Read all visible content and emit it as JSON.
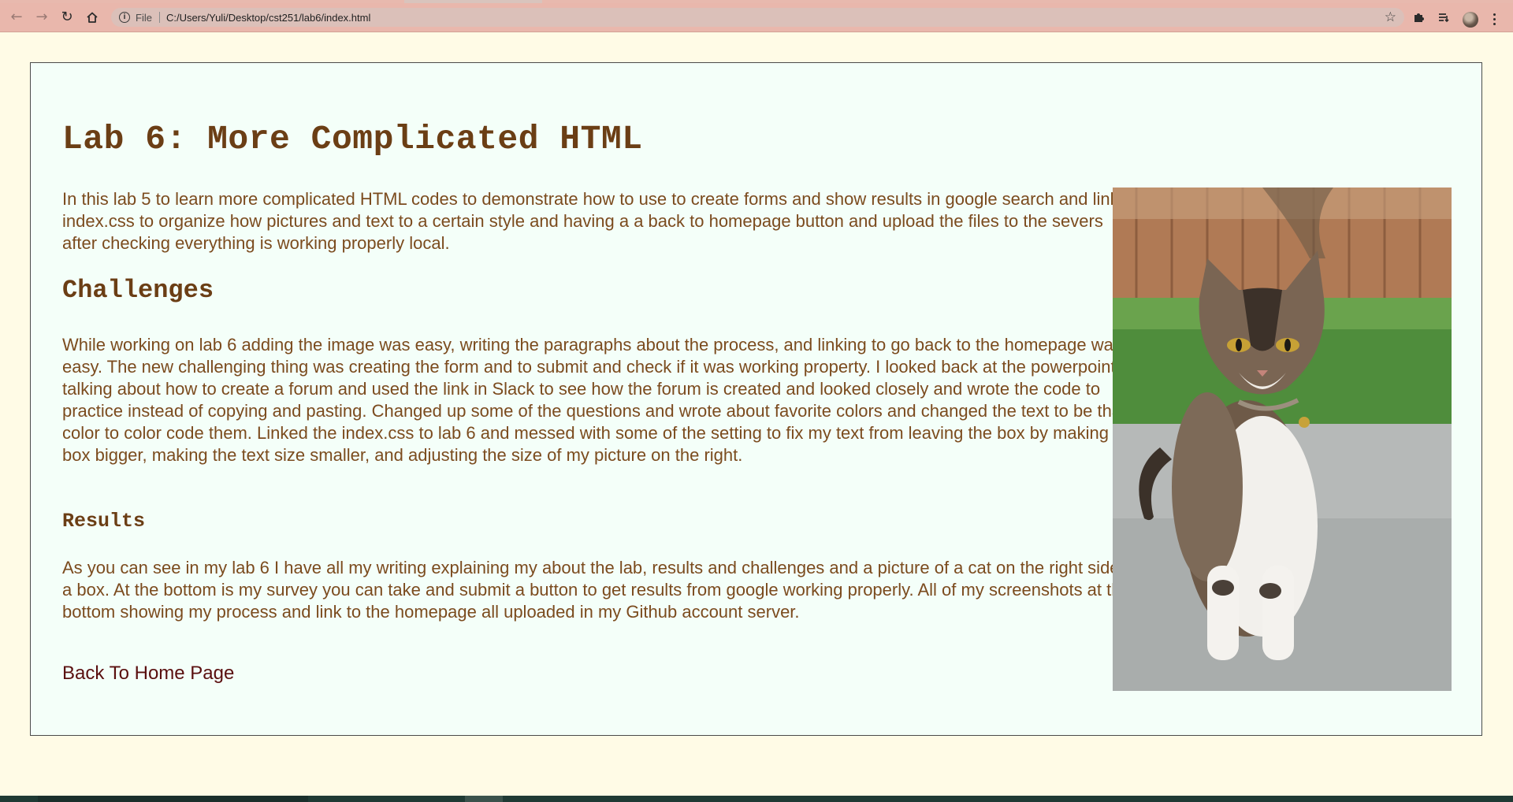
{
  "browser": {
    "scheme_label": "File",
    "url": "C:/Users/Yuli/Desktop/cst251/lab6/index.html",
    "icons": {
      "back": "back-arrow-icon",
      "forward": "forward-arrow-icon",
      "reload": "reload-icon",
      "home": "home-icon",
      "info": "info-icon",
      "star": "star-icon",
      "extensions": "puzzle-icon",
      "reading_list": "reading-list-icon",
      "menu": "kebab-menu-icon"
    },
    "colors": {
      "toolbar": "#e9b7ac",
      "omnibox": "#dbc0b9"
    }
  },
  "page": {
    "title": "Lab 6: More Complicated HTML",
    "intro": "In this lab 5 to learn more complicated HTML codes to demonstrate how to use to create forms and show results in google search and linking index.css to organize how pictures and text to a certain style and having a a back to homepage button and upload the files to the severs after checking everything is working properly local.",
    "challenges_heading": "Challenges",
    "challenges_text": "While working on lab 6 adding the image was easy, writing the paragraphs about the process, and linking to go back to the homepage was easy. The new challenging thing was creating the form and to submit and check if it was working property. I looked back at the powerpoint talking about how to create a forum and used the link in Slack to see how the forum is created and looked closely and wrote the code to practice instead of copying and pasting. Changed up some of the questions and wrote about favorite colors and changed the text to be that color to color code them. Linked the index.css to lab 6 and messed with some of the setting to fix my text from leaving the box by making the box bigger, making the text size smaller, and adjusting the size of my picture on the right.",
    "results_heading": "Results",
    "results_text": "As you can see in my lab 6 I have all my writing explaining my about the lab, results and challenges and a picture of a cat on the right side in a box. At the bottom is my survey you can take and submit a button to get results from google working properly. All of my screenshots at the bottom showing my process and link to the homepage all uploaded in my Github account server.",
    "home_link": "Back To Home Page",
    "colors": {
      "background": "#fffbe6",
      "box": "#f4fff9",
      "heading": "#6b3e15",
      "text": "#7b4b1e",
      "link": "#5a0f0f"
    }
  }
}
